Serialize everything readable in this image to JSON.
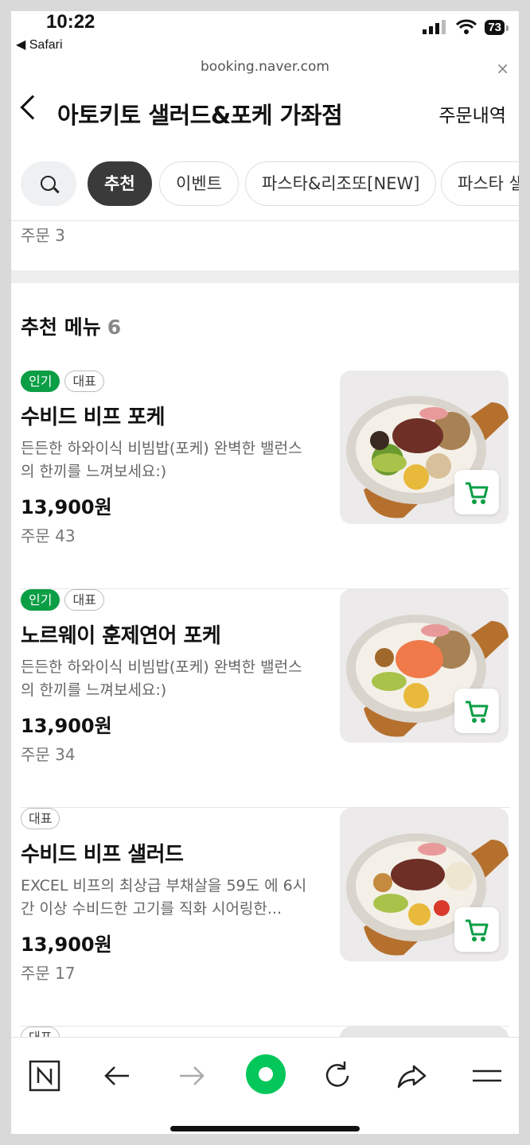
{
  "status": {
    "time": "10:22",
    "back_app": "◀ Safari",
    "battery": "73"
  },
  "browser": {
    "url": "booking.naver.com",
    "close": "×"
  },
  "header": {
    "title": "아토키토 샐러드&포케 가좌점",
    "order_history": "주문내역"
  },
  "chips": [
    {
      "label": "추천"
    },
    {
      "label": "이벤트"
    },
    {
      "label": "파스타&리조또[NEW]"
    },
    {
      "label": "파스타 샐러"
    }
  ],
  "prev_item_orders": "주문 3",
  "section": {
    "title": "추천 메뉴",
    "count": "6"
  },
  "items": [
    {
      "badges": [
        "인기",
        "대표"
      ],
      "name": "수비드 비프 포케",
      "desc": "든든한 하와이식 비빔밥(포케) 완벽한 밸런스의 한끼를 느껴보세요:)",
      "price": "13,900원",
      "orders": "주문 43"
    },
    {
      "badges": [
        "인기",
        "대표"
      ],
      "name": "노르웨이 훈제연어 포케",
      "desc": "든든한 하와이식 비빔밥(포케) 완벽한 밸런스의 한끼를 느껴보세요:)",
      "price": "13,900원",
      "orders": "주문 34"
    },
    {
      "badges": [
        "대표"
      ],
      "name": "수비드 비프 샐러드",
      "desc": "EXCEL 비프의 최상급 부채살을 59도 에 6시간 이상 수비드한 고기를 직화 시어링한...",
      "price": "13,900원",
      "orders": "주문 17"
    },
    {
      "badges": [
        "대표"
      ]
    }
  ],
  "colors": {
    "accent_green": "#0b9e45",
    "naver_green": "#03c75a"
  }
}
